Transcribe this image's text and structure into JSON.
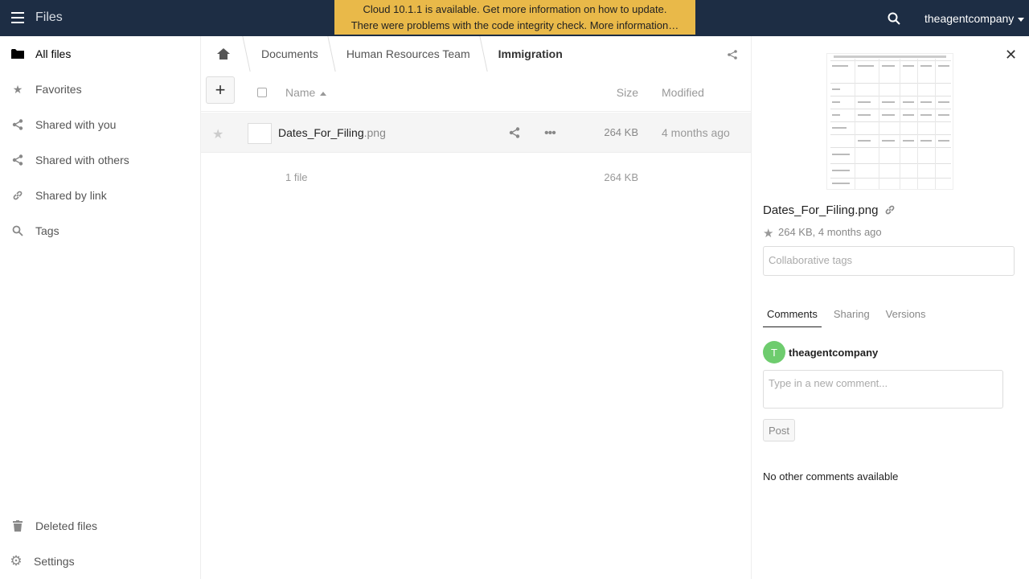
{
  "header": {
    "app_name": "Files",
    "update_notice": "Cloud 10.1.1 is available. Get more information on how to update.",
    "integrity_notice": "There were problems with the code integrity check. More information…",
    "user_name": "theagentcompany"
  },
  "sidebar": {
    "items": [
      {
        "label": "All files",
        "icon": "folder-icon"
      },
      {
        "label": "Favorites",
        "icon": "star-icon"
      },
      {
        "label": "Shared with you",
        "icon": "share-icon"
      },
      {
        "label": "Shared with others",
        "icon": "share-icon"
      },
      {
        "label": "Shared by link",
        "icon": "link-icon"
      },
      {
        "label": "Tags",
        "icon": "search-icon"
      }
    ],
    "deleted_files": "Deleted files",
    "settings": "Settings"
  },
  "breadcrumbs": [
    "Documents",
    "Human Resources Team",
    "Immigration"
  ],
  "file_list": {
    "columns": {
      "name": "Name",
      "size": "Size",
      "modified": "Modified"
    },
    "rows": [
      {
        "name": "Dates_For_Filing",
        "ext": ".png",
        "size": "264 KB",
        "modified": "4 months ago"
      }
    ],
    "summary": {
      "count": "1 file",
      "size": "264 KB"
    }
  },
  "details": {
    "filename": "Dates_For_Filing.png",
    "meta": "264 KB, 4 months ago",
    "tags_placeholder": "Collaborative tags",
    "tabs": [
      "Comments",
      "Sharing",
      "Versions"
    ],
    "commenter_initial": "T",
    "commenter_name": "theagentcompany",
    "comment_placeholder": "Type in a new comment...",
    "post_label": "Post",
    "no_comments": "No other comments available"
  },
  "colors": {
    "header_bg": "#1d2d44",
    "banner_bg": "#e9b949",
    "avatar_bg": "#6ecc6e"
  }
}
